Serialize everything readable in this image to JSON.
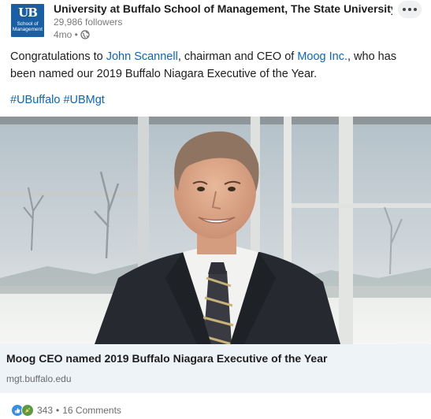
{
  "author": {
    "logo_mark": "UB",
    "logo_text_line1": "School of",
    "logo_text_line2": "Management",
    "name": "University at Buffalo School of Management, The State University...",
    "followers": "29,986 followers",
    "time": "4mo •",
    "visibility_icon": "globe-icon"
  },
  "menu_icon": "more-horizontal-icon",
  "post": {
    "text_before": "Congratulations to ",
    "mention_person": "John Scannell",
    "text_middle": ", chairman and CEO of ",
    "mention_company": "Moog Inc.",
    "text_after": ", who has been named our 2019 Buffalo Niagara Executive of the Year.",
    "hashtag1": "#UBuffalo",
    "hashtag2": "#UBMgt"
  },
  "link_card": {
    "title": "Moog CEO named 2019 Buffalo Niagara Executive of the Year",
    "domain": "mgt.buffalo.edu"
  },
  "social": {
    "reaction_icons": [
      "like-icon",
      "celebrate-icon"
    ],
    "reaction_count": "343",
    "separator": "•",
    "comments": "16 Comments"
  },
  "colors": {
    "link": "#0a66c2",
    "logo_bg": "#1a5fa3",
    "card_bg": "#eef3f8"
  }
}
